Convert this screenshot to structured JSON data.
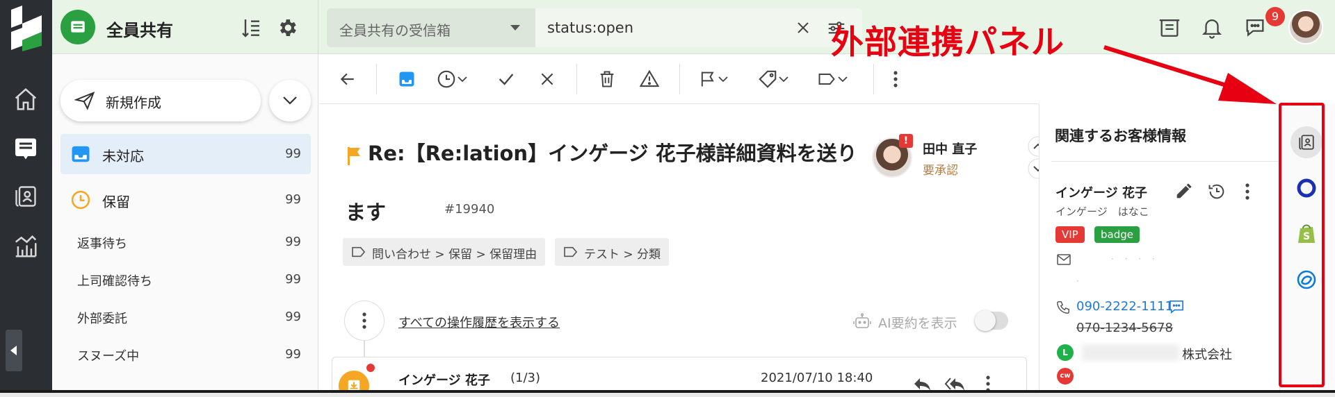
{
  "app": {
    "workspace_name": "全員共有",
    "inbox_selector": "全員共有の受信箱",
    "search_query": "status:open",
    "notification_count": "9"
  },
  "sidebar": {
    "compose_label": "新規作成",
    "folders": [
      {
        "label": "未対応",
        "count": "99",
        "active": true
      },
      {
        "label": "保留",
        "count": "99"
      }
    ],
    "subfolders": [
      {
        "label": "返事待ち",
        "count": "99"
      },
      {
        "label": "上司確認待ち",
        "count": "99"
      },
      {
        "label": "外部委託",
        "count": "99"
      },
      {
        "label": "スヌーズ中",
        "count": "99"
      }
    ]
  },
  "ticket": {
    "subject_line1": "Re:【Re:lation】インゲージ 花子様詳細資料を送り",
    "subject_line2": "ます",
    "number": "#19940",
    "tags": [
      "問い合わせ > 保留 > 保留理由",
      "テスト > 分類"
    ],
    "assignee_alert": "!",
    "assignee_name": "田中 直子",
    "assignee_status": "要承認",
    "history_link": "すべての操作履歴を表示する",
    "ai_summary_label": "AI要約を表示",
    "message": {
      "from": "インゲージ 花子",
      "count": "(1/3)",
      "date": "2021/07/10 18:40"
    }
  },
  "customer": {
    "heading": "関連するお客様情報",
    "name": "インゲージ 花子",
    "kana": "インゲージ　はなこ",
    "badges": [
      {
        "label": "VIP",
        "color": "#e53935"
      },
      {
        "label": "badge",
        "color": "#2aa040"
      }
    ],
    "phone_primary": "090-2222-1111",
    "phone_old": "070-1234-5678",
    "line_badge": "L",
    "company": "株式会社",
    "cw_badge": "cw"
  },
  "annotation": {
    "label": "外部連携パネル",
    "color": "#e60012"
  },
  "colors": {
    "brand_green": "#2aa040",
    "rail_dark": "#2b2f33",
    "topbar_bg": "#e8f5e6",
    "link_blue": "#1e7ad6"
  }
}
